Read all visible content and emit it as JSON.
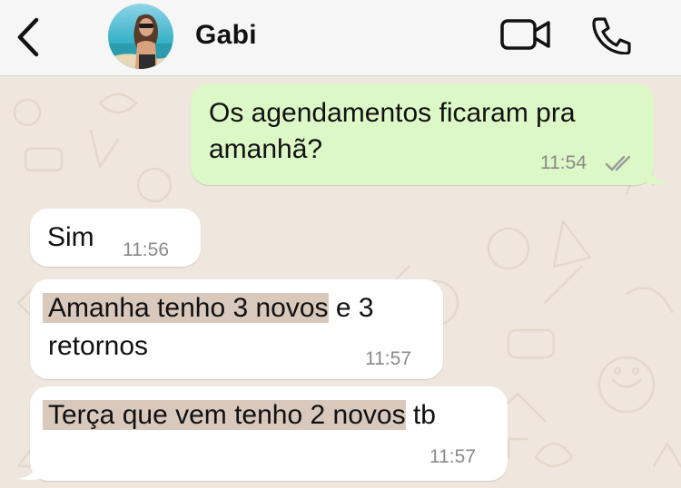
{
  "header": {
    "back_icon": "chevron-left-icon",
    "contact_name": "Gabi",
    "video_icon": "video-camera-icon",
    "call_icon": "phone-icon"
  },
  "colors": {
    "header_bg": "#f6f6f6",
    "chat_bg": "#efe7dd",
    "outgoing_bubble": "#dcf8c6",
    "incoming_bubble": "#ffffff",
    "highlight": "#d9c9bd",
    "timestamp": "#8a8a8a"
  },
  "messages": [
    {
      "direction": "outgoing",
      "lines": [
        "Os agendamentos ficaram pra",
        "amanhã?"
      ],
      "time": "11:54",
      "status_icon": "double-check-icon"
    },
    {
      "direction": "incoming",
      "text": "Sim",
      "time": "11:56"
    },
    {
      "direction": "incoming",
      "highlighted": "Amanha tenho 3 novos",
      "rest": " e 3",
      "line2": "retornos",
      "time": "11:57"
    },
    {
      "direction": "incoming",
      "highlighted": "Terça que vem tenho 2 novos",
      "rest": " tb",
      "time": "11:57"
    }
  ]
}
